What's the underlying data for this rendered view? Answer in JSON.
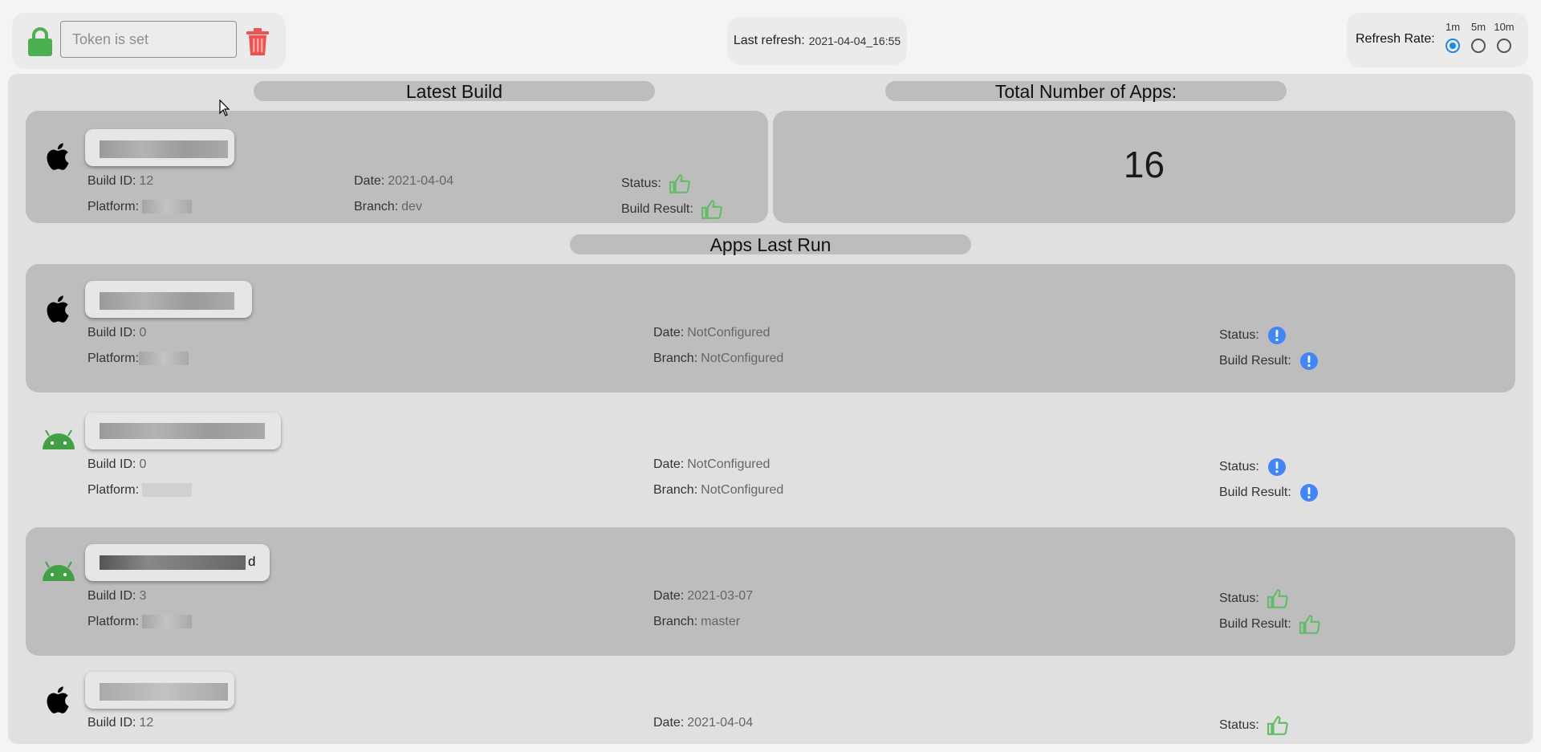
{
  "token": {
    "placeholder": "Token is set",
    "lock_icon": "lock-icon",
    "delete_icon": "trash-icon",
    "lock_color": "#4caf50",
    "delete_color": "#ef5350"
  },
  "refresh": {
    "label": "Last refresh:",
    "timestamp": "2021-04-04_16:55"
  },
  "refresh_rate": {
    "label": "Refresh Rate:",
    "options": [
      "1m",
      "5m",
      "10m"
    ],
    "selected": "1m"
  },
  "sections": {
    "latest_build": "Latest Build",
    "total_apps": "Total Number of Apps:",
    "apps_last_run": "Apps Last Run"
  },
  "total_apps_value": "16",
  "labels": {
    "build_id": "Build ID:",
    "date": "Date:",
    "status": "Status:",
    "platform": "Platform:",
    "branch": "Branch:",
    "build_result": "Build Result:"
  },
  "latest_build": {
    "os": "apple",
    "build_id": "12",
    "date": "2021-04-04",
    "branch": "dev",
    "status": "success",
    "build_result": "success"
  },
  "apps": [
    {
      "os": "apple",
      "build_id": "0",
      "date": "NotConfigured",
      "branch": "NotConfigured",
      "status": "info",
      "build_result": "info"
    },
    {
      "os": "android",
      "build_id": "0",
      "date": "NotConfigured",
      "branch": "NotConfigured",
      "status": "info",
      "build_result": "info"
    },
    {
      "os": "android",
      "name_suffix": "d",
      "build_id": "3",
      "date": "2021-03-07",
      "branch": "master",
      "status": "success",
      "build_result": "success"
    },
    {
      "os": "apple",
      "build_id": "12",
      "date": "2021-04-04",
      "status": "success"
    }
  ],
  "colors": {
    "success": "#66bb6a",
    "info": "#4285f4",
    "android": "#43a047",
    "radio_selected": "#1e88e5"
  }
}
